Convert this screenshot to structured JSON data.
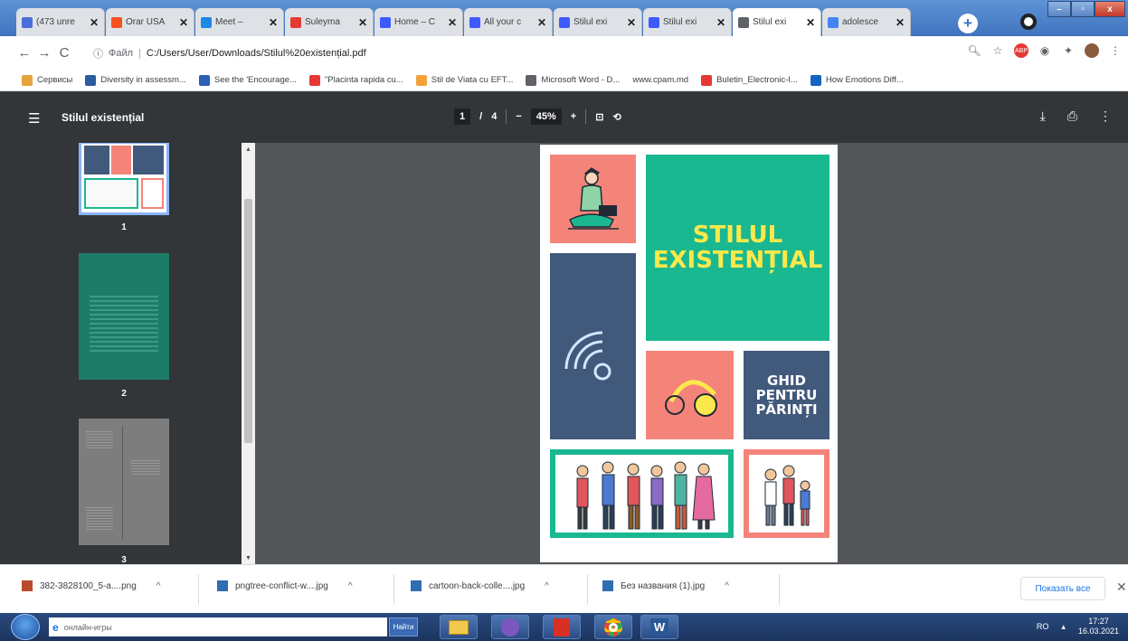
{
  "tabs": [
    {
      "title": "(473 unre",
      "color": "#4a6fdc",
      "active": false
    },
    {
      "title": "Orar USA",
      "color": "#f4511e",
      "active": false
    },
    {
      "title": "Meet – ",
      "color": "#1e88e5",
      "active": false
    },
    {
      "title": "Suleyma",
      "color": "#e53935",
      "active": false
    },
    {
      "title": "Home – C",
      "color": "#3d5afe",
      "active": false
    },
    {
      "title": "All your c",
      "color": "#3d5afe",
      "active": false
    },
    {
      "title": "Stilul exi",
      "color": "#3d5afe",
      "active": false
    },
    {
      "title": "Stilul exi",
      "color": "#3d5afe",
      "active": false
    },
    {
      "title": "Stilul exi",
      "color": "#5f6368",
      "active": true
    },
    {
      "title": "adolesce",
      "color": "#4285f4",
      "active": false
    }
  ],
  "tab_close": "✕",
  "address": {
    "prefix": "Файл",
    "url": "C:/Users/User/Downloads/Stilul%20existențial.pdf"
  },
  "bookmarks": [
    {
      "label": "Сервисы",
      "color": "#e8a33b"
    },
    {
      "label": "Diversity in assessm...",
      "color": "#2c5aa0"
    },
    {
      "label": "See the 'Encourage...",
      "color": "#2b5fb8"
    },
    {
      "label": "\"Placinta rapida cu...",
      "color": "#e53935"
    },
    {
      "label": "Stil de Viata cu EFT...",
      "color": "#f2a23a"
    },
    {
      "label": "Microsoft Word - D...",
      "color": "#5f6368"
    },
    {
      "label": "www.cpam.md",
      "color": "#ffffff"
    },
    {
      "label": "Buletin_Electronic-I...",
      "color": "#e53935"
    },
    {
      "label": "How Emotions Diff...",
      "color": "#1565c0"
    }
  ],
  "viewer": {
    "title": "Stilul existențial",
    "page_current": "1",
    "page_sep": "/",
    "page_total": "4",
    "zoom": "45%",
    "minus": "−",
    "plus": "+"
  },
  "thumbnails": [
    "1",
    "2",
    "3"
  ],
  "document": {
    "title_line1": "STILUL",
    "title_line2": "EXISTENȚIAL",
    "guide_line1": "GHID",
    "guide_line2": "PENTRU",
    "guide_line3": "PĂRINȚI",
    "colors": {
      "salmon": "#f4847a",
      "teal": "#1ab891",
      "slate": "#41597b",
      "yellow": "#fbe94b"
    }
  },
  "downloads": [
    {
      "name": "382-3828100_5-a....png",
      "color": "#b84a2e"
    },
    {
      "name": "pngtree-conflict-w....jpg",
      "color": "#2f6db5"
    },
    {
      "name": "cartoon-back-colle....jpg",
      "color": "#2f6db5"
    },
    {
      "name": "Без названия (1).jpg",
      "color": "#2f6db5"
    }
  ],
  "download_chevron": "^",
  "show_all": "Показать все",
  "taskbar": {
    "search_text": "онлайн-игры",
    "search_button": "Найти",
    "lang": "RO",
    "time": "17:27",
    "date": "16.03.2021"
  }
}
